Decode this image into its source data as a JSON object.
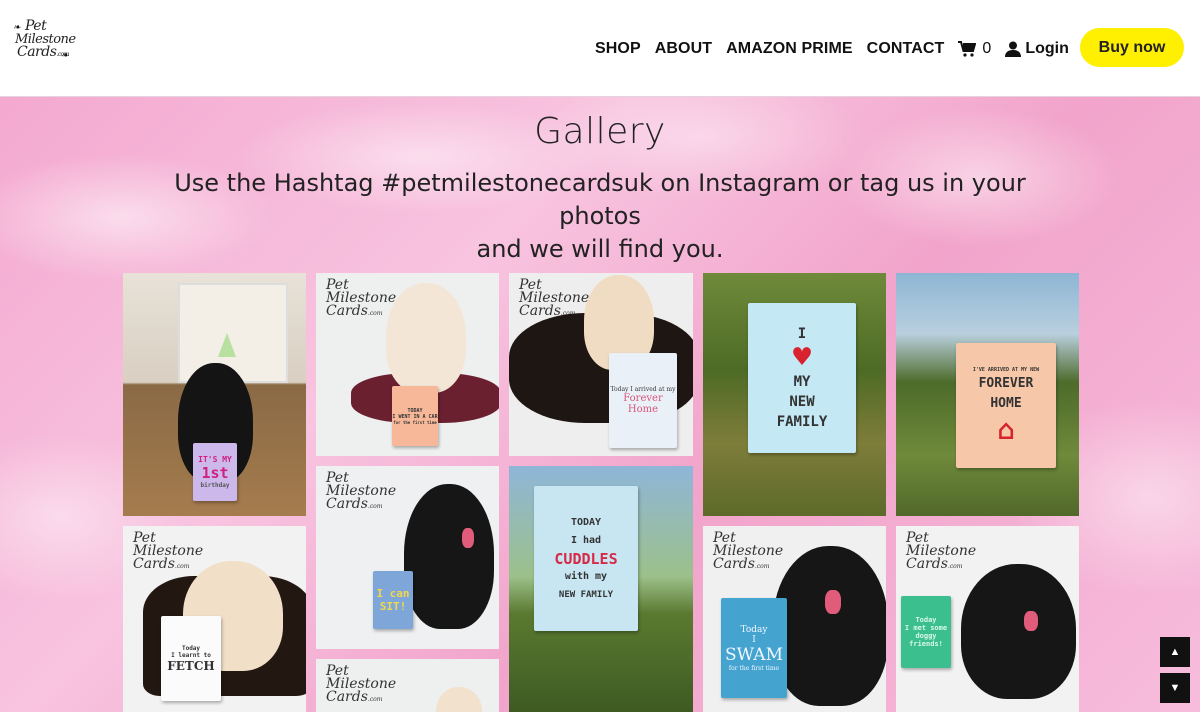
{
  "header": {
    "logo": {
      "line1": "Pet",
      "line2": "Milestone",
      "line3": "Cards",
      "suffix": ".com"
    },
    "nav": [
      {
        "label": "SHOP"
      },
      {
        "label": "ABOUT"
      },
      {
        "label": "AMAZON PRIME"
      },
      {
        "label": "CONTACT"
      }
    ],
    "cart_count": "0",
    "login_label": "Login",
    "buy_label": "Buy now"
  },
  "gallery": {
    "title": "Gallery",
    "subtitle_line1": "Use the Hashtag #petmilestonecardsuk on Instagram or tag us in your photos",
    "subtitle_line2": "and we will find you.",
    "watermark": {
      "line1": "Pet",
      "line2": "Milestone",
      "line3": "Cards",
      "suffix": ".com"
    },
    "cards": {
      "birthday": {
        "l1": "IT'S MY",
        "l2": "1st",
        "l3": "birthday"
      },
      "car": {
        "l1": "TODAY",
        "l2": "I WENT IN A CAR",
        "l3": "for the first time"
      },
      "arrived": {
        "l1": "Today I arrived at my",
        "l2": "Forever Home"
      },
      "family": {
        "l1": "I",
        "l2": "MY",
        "l3": "NEW",
        "l4": "FAMILY"
      },
      "forever": {
        "l1": "I'VE ARRIVED AT MY NEW",
        "l2": "FOREVER",
        "l3": "HOME"
      },
      "sit": {
        "l1": "I can",
        "l2": "SIT!"
      },
      "cuddles": {
        "l1": "TODAY",
        "l2": "I had",
        "l3": "CUDDLES",
        "l4": "with my",
        "l5": "NEW FAMILY"
      },
      "fetch": {
        "l1": "Today",
        "l2": "I learnt to",
        "l3": "FETCH"
      },
      "swam": {
        "l1": "Today",
        "l2": "I",
        "l3": "SWAM",
        "l4": "for the first time"
      },
      "friends": {
        "l1": "Today",
        "l2": "I met some",
        "l3": "doggy friends!"
      }
    }
  },
  "scroll": {
    "up": "▲",
    "down": "▼"
  }
}
